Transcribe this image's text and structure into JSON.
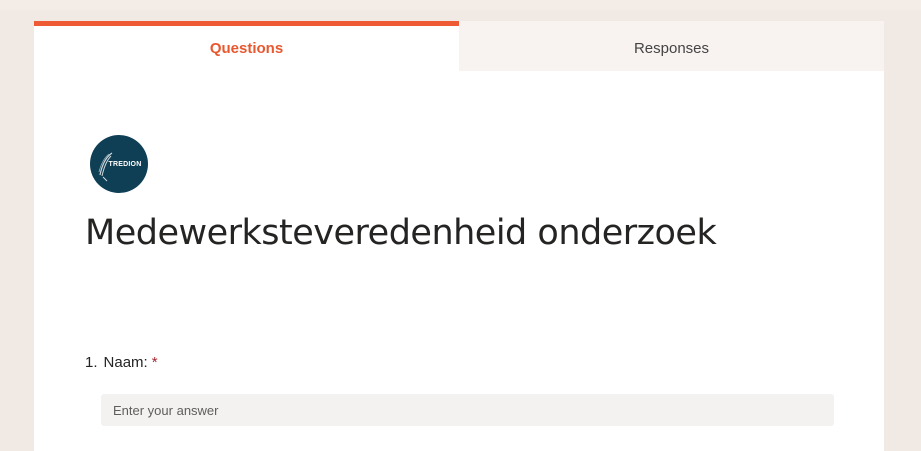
{
  "tabs": {
    "questions_label": "Questions",
    "responses_label": "Responses"
  },
  "logo": {
    "text": "TREDION",
    "background": "#0f3f55"
  },
  "form": {
    "title": "Medewerksteveredenheid onderzoek"
  },
  "questions": [
    {
      "number": "1.",
      "label": "Naam:",
      "required_mark": "*",
      "placeholder": "Enter your answer"
    }
  ],
  "colors": {
    "accent": "#ee5a34",
    "page_background": "#f1e9e4",
    "required": "#a4262c"
  }
}
